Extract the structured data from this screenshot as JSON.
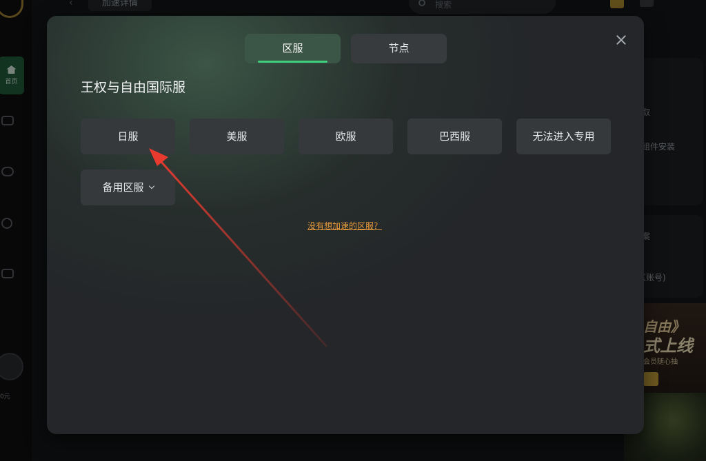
{
  "background": {
    "top_tab": "加速详情",
    "search_placeholder": "搜索",
    "home_label": "首页",
    "avatar_label": "0元",
    "right_panel": {
      "line1": "取",
      "line2": "组件安装",
      "line3": "案",
      "line4": "区账号)",
      "promo_line1": "自由》",
      "promo_line2": "式上线",
      "promo_line3": "会员随心抽"
    }
  },
  "modal": {
    "tabs": {
      "region": "区服",
      "node": "节点"
    },
    "game_title": "王权与自由国际服",
    "servers": [
      "日服",
      "美服",
      "欧服",
      "巴西服",
      "无法进入专用"
    ],
    "backup_server": "备用区服",
    "help_link": "没有想加速的区服？"
  },
  "colors": {
    "accent_green": "#3ecf7a",
    "active_tab": "#3b5646",
    "link_orange": "#e89a3c",
    "annotation_arrow": "#e83a2f"
  }
}
